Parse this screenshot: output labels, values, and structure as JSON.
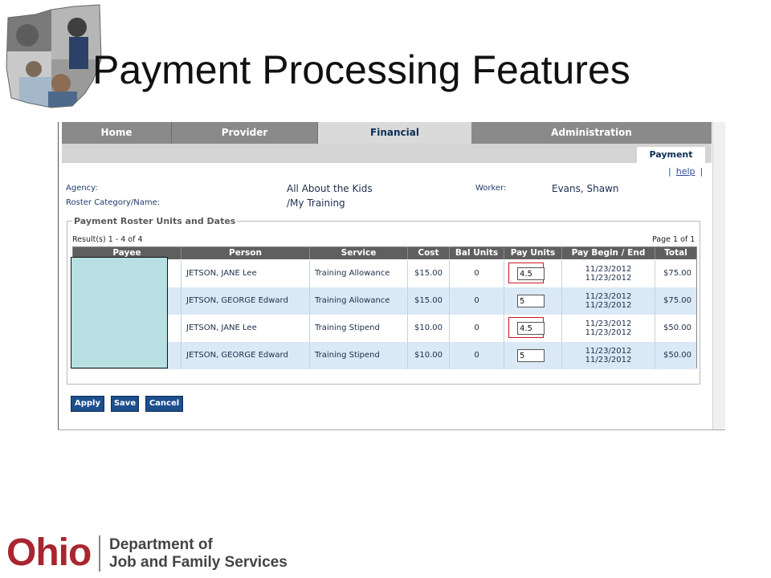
{
  "slide": {
    "title": "Payment Processing Features"
  },
  "nav": {
    "tabs": [
      {
        "label": "Home",
        "active": false
      },
      {
        "label": "Provider",
        "active": false
      },
      {
        "label": "Financial",
        "active": true
      },
      {
        "label": "Administration",
        "active": false
      }
    ],
    "subtab": "Payment"
  },
  "help": {
    "label": "help"
  },
  "info": {
    "agency_label": "Agency:",
    "agency_value": "All About the Kids",
    "roster_label": "Roster Category/Name:",
    "roster_value": "/My Training",
    "worker_label": "Worker:",
    "worker_value": "Evans, Shawn"
  },
  "roster": {
    "legend": "Payment Roster Units and Dates",
    "results_text": "Result(s) 1 - 4 of 4",
    "page_text": "Page 1 of 1",
    "columns": [
      "Payee",
      "Person",
      "Service",
      "Cost",
      "Bal Units",
      "Pay Units",
      "Pay Begin / End",
      "Total"
    ],
    "rows": [
      {
        "person": "JETSON, JANE Lee",
        "service": "Training Allowance",
        "cost": "$15.00",
        "bal_units": "0",
        "pay_units": "4.5",
        "begin": "11/23/2012",
        "end": "11/23/2012",
        "total": "$75.00",
        "highlighted": true
      },
      {
        "person": "JETSON, GEORGE Edward",
        "service": "Training Allowance",
        "cost": "$15.00",
        "bal_units": "0",
        "pay_units": "5",
        "begin": "11/23/2012",
        "end": "11/23/2012",
        "total": "$75.00",
        "highlighted": false
      },
      {
        "person": "JETSON, JANE Lee",
        "service": "Training Stipend",
        "cost": "$10.00",
        "bal_units": "0",
        "pay_units": "4.5",
        "begin": "11/23/2012",
        "end": "11/23/2012",
        "total": "$50.00",
        "highlighted": true
      },
      {
        "person": "JETSON, GEORGE Edward",
        "service": "Training Stipend",
        "cost": "$10.00",
        "bal_units": "0",
        "pay_units": "5",
        "begin": "11/23/2012",
        "end": "11/23/2012",
        "total": "$50.00",
        "highlighted": false
      }
    ]
  },
  "buttons": {
    "apply": "Apply",
    "save": "Save",
    "cancel": "Cancel"
  },
  "footer": {
    "logo_text": "Ohio",
    "dept_line1": "Department of",
    "dept_line2": "Job and Family Services"
  },
  "colors": {
    "brand_red": "#a8262f",
    "nav_gray": "#8a8a8a",
    "button_blue": "#1d4f8f",
    "row_alt": "#dbe8f5",
    "highlight_red": "#c8191f"
  }
}
